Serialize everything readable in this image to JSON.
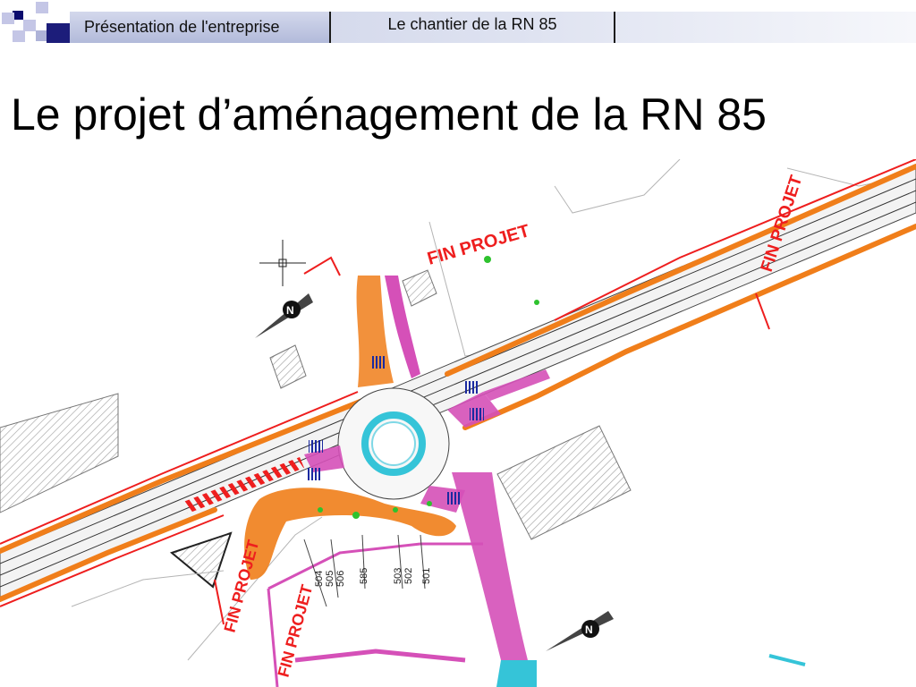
{
  "tabs": [
    {
      "label": "Présentation de l'entreprise"
    },
    {
      "label": "Le chantier de la RN 85"
    }
  ],
  "title": "Le projet d’aménagement de la RN 85",
  "plan": {
    "labels": {
      "fin_projet_top": "FIN PROJET",
      "fin_projet_right": "FIN PROJET",
      "fin_projet_left": "FIN PROJET",
      "fin_projet_bottom": "FIN PROJET"
    },
    "profile_numbers": [
      "504",
      "505",
      "506",
      "503",
      "502",
      "501",
      "585"
    ],
    "colors": {
      "road_fill": "#f07e1a",
      "curb_red": "#ee1e1e",
      "pink": "#d550b8",
      "cyan": "#35c4d8",
      "hatch": "#9a9a9a",
      "crossing": "#1a2aa0"
    }
  }
}
